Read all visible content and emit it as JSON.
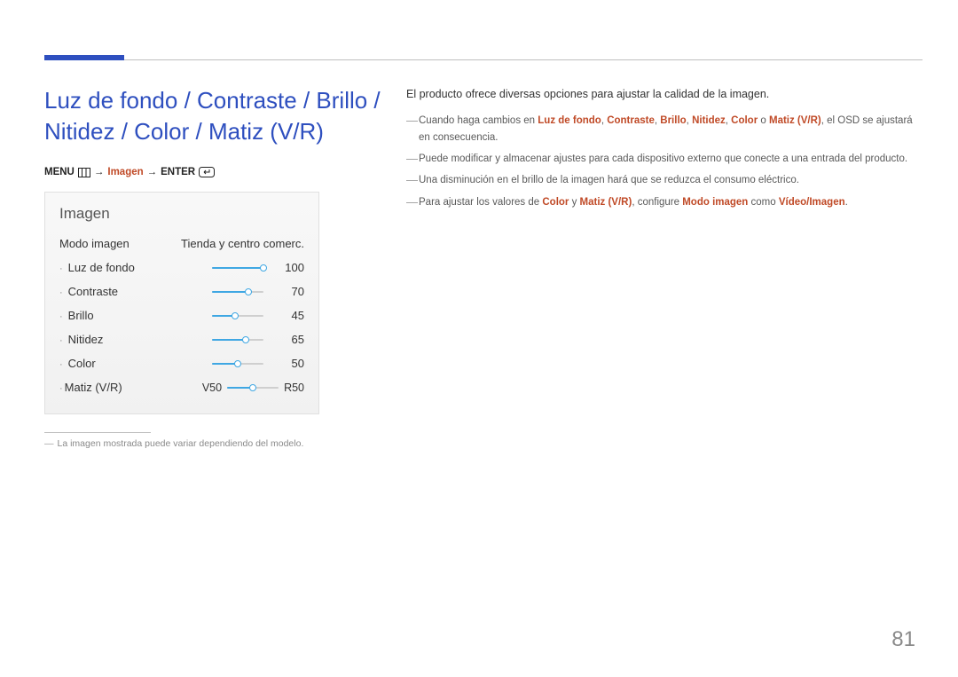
{
  "page_number": "81",
  "heading": "Luz de fondo / Contraste / Brillo / Nitidez / Color / Matiz (V/R)",
  "breadcrumb": {
    "menu": "MENU",
    "arrow": "→",
    "imagen": "Imagen",
    "enter": "ENTER"
  },
  "panel": {
    "title": "Imagen",
    "mode_label": "Modo imagen",
    "mode_value": "Tienda y centro comerc.",
    "sliders": [
      {
        "label": "Luz de fondo",
        "value": "100",
        "pct": 100
      },
      {
        "label": "Contraste",
        "value": "70",
        "pct": 70
      },
      {
        "label": "Brillo",
        "value": "45",
        "pct": 45
      },
      {
        "label": "Nitidez",
        "value": "65",
        "pct": 65
      },
      {
        "label": "Color",
        "value": "50",
        "pct": 50
      }
    ],
    "matiz": {
      "label": "Matiz (V/R)",
      "left": "V50",
      "right": "R50",
      "pct": 50
    }
  },
  "footnote": "La imagen mostrada puede variar dependiendo del modelo.",
  "right": {
    "intro": "El producto ofrece diversas opciones para ajustar la calidad de la imagen.",
    "b1_pre": "Cuando haga cambios en ",
    "b1_k1": "Luz de fondo",
    "b1_s1": ", ",
    "b1_k2": "Contraste",
    "b1_s2": ", ",
    "b1_k3": "Brillo",
    "b1_s3": ", ",
    "b1_k4": "Nitidez",
    "b1_s4": ", ",
    "b1_k5": "Color",
    "b1_s5": " o ",
    "b1_k6": "Matiz (V/R)",
    "b1_post": ", el OSD se ajustará en consecuencia.",
    "b2": "Puede modificar y almacenar ajustes para cada dispositivo externo que conecte a una entrada del producto.",
    "b3": "Una disminución en el brillo de la imagen hará que se reduzca el consumo eléctrico.",
    "b4_pre": "Para ajustar los valores de ",
    "b4_k1": "Color",
    "b4_s1": " y ",
    "b4_k2": "Matiz (V/R)",
    "b4_mid": ", configure ",
    "b4_k3": "Modo imagen",
    "b4_s2": " como ",
    "b4_k4": "Vídeo/Imagen",
    "b4_post": "."
  }
}
